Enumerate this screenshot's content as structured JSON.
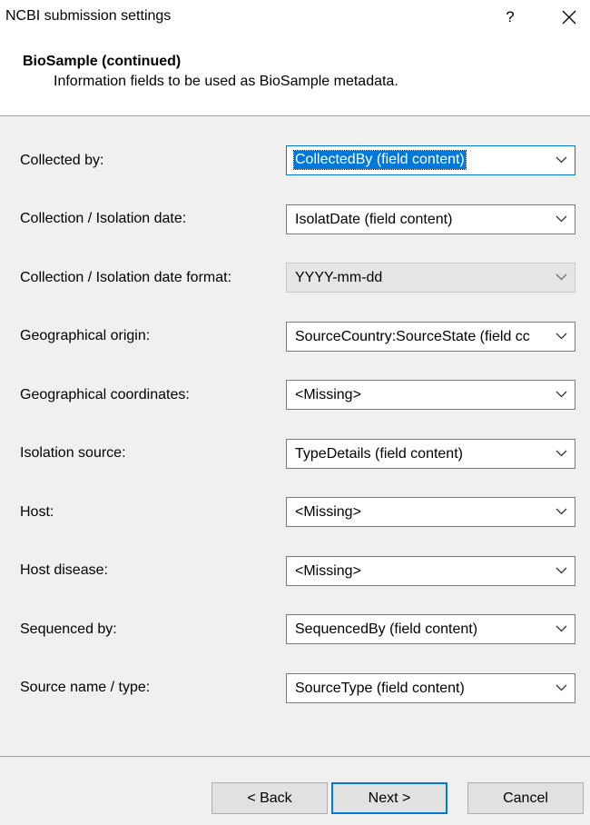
{
  "window": {
    "title": "NCBI submission settings",
    "help_label": "?"
  },
  "header": {
    "title": "BioSample (continued)",
    "subtitle": "Information fields to be used as BioSample metadata."
  },
  "fields": [
    {
      "label": "Collected by:",
      "value": "CollectedBy (field content)"
    },
    {
      "label": "Collection / Isolation date:",
      "value": "IsolatDate (field content)"
    },
    {
      "label": "Collection / Isolation date format:",
      "value": "YYYY-mm-dd"
    },
    {
      "label": "Geographical origin:",
      "value": "SourceCountry:SourceState (field cc"
    },
    {
      "label": "Geographical coordinates:",
      "value": "<Missing>"
    },
    {
      "label": "Isolation source:",
      "value": "TypeDetails (field content)"
    },
    {
      "label": "Host:",
      "value": "<Missing>"
    },
    {
      "label": "Host disease:",
      "value": "<Missing>"
    },
    {
      "label": "Sequenced by:",
      "value": "SequencedBy (field content)"
    },
    {
      "label": "Source name / type:",
      "value": "SourceType (field content)"
    }
  ],
  "buttons": {
    "back": "< Back",
    "next": "Next >",
    "cancel": "Cancel"
  },
  "colors": {
    "accent": "#0078d7",
    "background": "#f0f0f0",
    "header_bg": "#ffffff"
  }
}
